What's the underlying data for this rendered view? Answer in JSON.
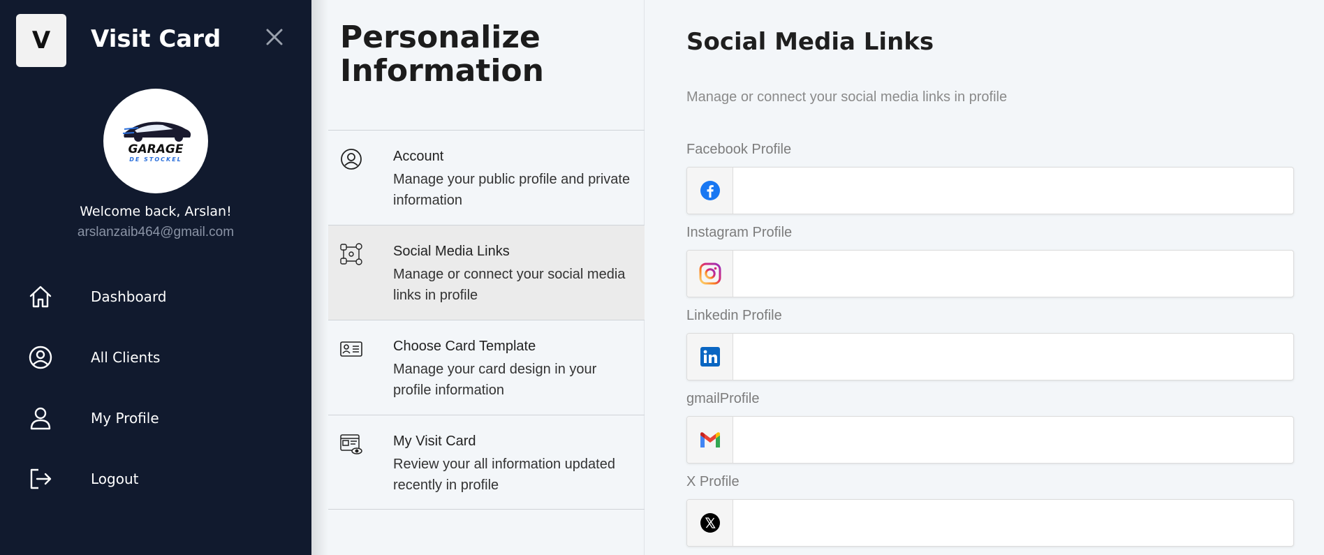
{
  "sidebar": {
    "logo_letter": "V",
    "app_title": "Visit Card",
    "avatar_brand": "GARAGE",
    "avatar_brand_sub": "DE STOCKEL",
    "welcome": "Welcome back, Arslan!",
    "email": "arslanzaib464@gmail.com",
    "nav": [
      {
        "label": "Dashboard",
        "icon": "home-icon"
      },
      {
        "label": "All Clients",
        "icon": "user-circle-icon"
      },
      {
        "label": "My Profile",
        "icon": "user-icon"
      },
      {
        "label": "Logout",
        "icon": "logout-icon"
      }
    ]
  },
  "middle": {
    "title_line1": "Personalize",
    "title_line2": "Information",
    "items": [
      {
        "title": "Account",
        "desc": "Manage your public profile and private information",
        "icon": "account-icon"
      },
      {
        "title": "Social Media Links",
        "desc": "Manage or connect your social media links in profile",
        "icon": "social-links-icon",
        "active": true
      },
      {
        "title": "Choose Card Template",
        "desc": "Manage your card design in your profile information",
        "icon": "id-card-icon"
      },
      {
        "title": "My Visit Card",
        "desc": "Review your all information updated recently in profile",
        "icon": "visit-card-icon"
      }
    ]
  },
  "main": {
    "title": "Social Media Links",
    "subtitle": "Manage or connect your social media links in profile",
    "fields": [
      {
        "label": "Facebook Profile",
        "value": "",
        "icon": "facebook-icon"
      },
      {
        "label": "Instagram Profile",
        "value": "",
        "icon": "instagram-icon"
      },
      {
        "label": "Linkedin Profile",
        "value": "",
        "icon": "linkedin-icon"
      },
      {
        "label": "gmailProfile",
        "value": "",
        "icon": "gmail-icon"
      },
      {
        "label": "X Profile",
        "value": "",
        "icon": "x-icon"
      }
    ]
  },
  "colors": {
    "sidebar_bg": "#111a2e",
    "panel_bg": "#f3f6f9",
    "active_item_bg": "#ebebeb",
    "facebook": "#1877f2",
    "linkedin": "#0a66c2"
  }
}
